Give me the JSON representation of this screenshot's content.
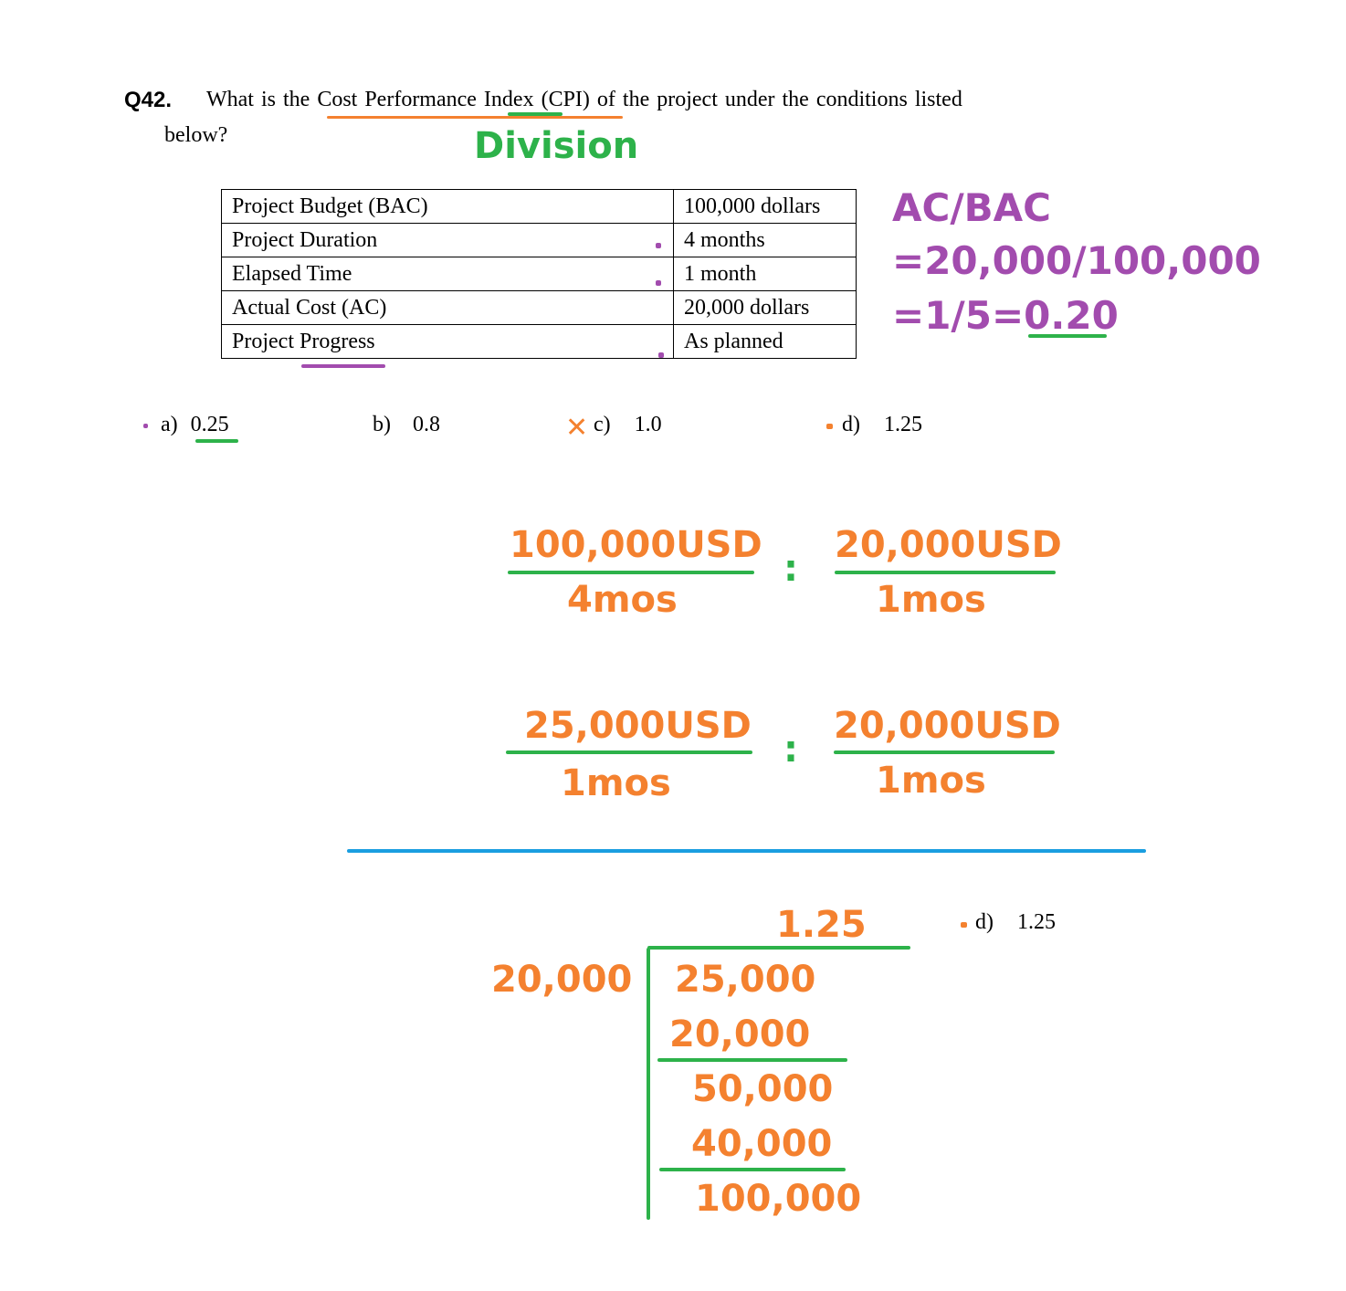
{
  "question": {
    "number": "Q42.",
    "line1_prefix": "What is the",
    "line1_highlight": "Cost Performance Index",
    "line1_suffix": "(CPI) of the project under the conditions listed",
    "line2": "below?"
  },
  "annotation_title": "Division",
  "conditions": {
    "rows": [
      {
        "label": "Project Budget (BAC)",
        "value": "100,000 dollars"
      },
      {
        "label": "Project Duration",
        "value": "4 months"
      },
      {
        "label": "Elapsed Time",
        "value": "1 month"
      },
      {
        "label": "Actual Cost (AC)",
        "value": "20,000 dollars"
      },
      {
        "label": "Project Progress",
        "value": "As planned"
      }
    ]
  },
  "formula": {
    "line1": "AC/BAC",
    "line2": "=20,000/100,000",
    "line3": "=1/5=0.20"
  },
  "choices": [
    {
      "letter": "a)",
      "value": "0.25"
    },
    {
      "letter": "b)",
      "value": "0.8"
    },
    {
      "letter": "c)",
      "value": "1.0",
      "mark": "✕"
    },
    {
      "letter": "d)",
      "value": "1.25"
    }
  ],
  "ratio1": {
    "left_num": "100,000USD",
    "left_den": "4mos",
    "sep": ":",
    "right_num": "20,000USD",
    "right_den": "1mos"
  },
  "ratio2": {
    "left_num": "25,000USD",
    "left_den": "1mos",
    "sep": ":",
    "right_num": "20,000USD",
    "right_den": "1mos"
  },
  "long_division": {
    "quotient": "1.25",
    "divisor": "20,000",
    "dividend": "25,000",
    "step1": "20,000",
    "step2": "50,000",
    "step3": "40,000",
    "step4": "100,000"
  },
  "answer_repeat": {
    "letter": "d)",
    "value": "1.25"
  },
  "colors": {
    "orange": "#f4812f",
    "green": "#2db24a",
    "purple": "#a24cae",
    "blue": "#1a9ee0"
  }
}
